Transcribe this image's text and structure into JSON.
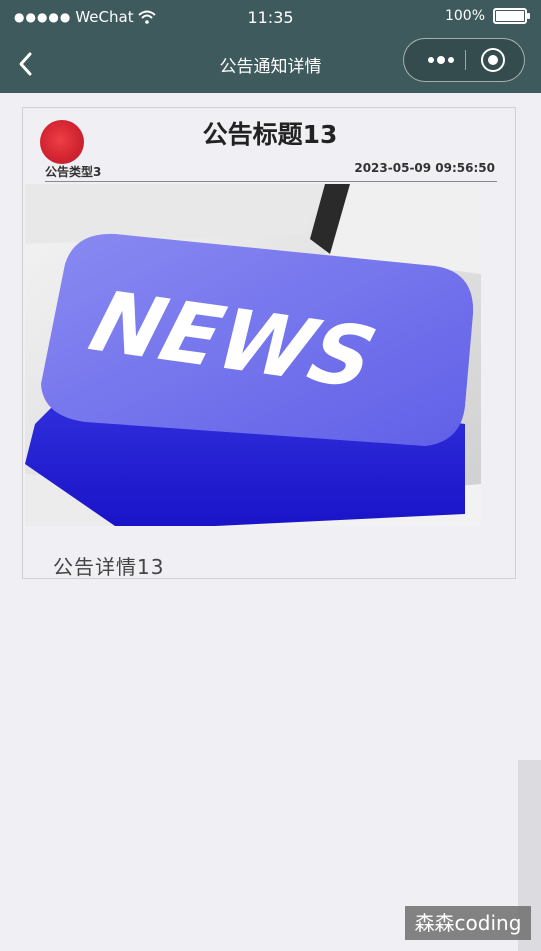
{
  "status": {
    "signal": "●●●●●",
    "carrier": "WeChat",
    "time": "11:35",
    "battery": "100%"
  },
  "nav": {
    "title": "公告通知详情"
  },
  "announcement": {
    "title": "公告标题13",
    "type": "公告类型3",
    "datetime": "2023-05-09 09:56:50",
    "image_text": "NEWS",
    "detail": "公告详情13"
  },
  "watermark": "森森coding",
  "colors": {
    "topbar": "#3f5a5c",
    "key_blue": "#6f6fee",
    "avatar_red": "#d42a36"
  }
}
